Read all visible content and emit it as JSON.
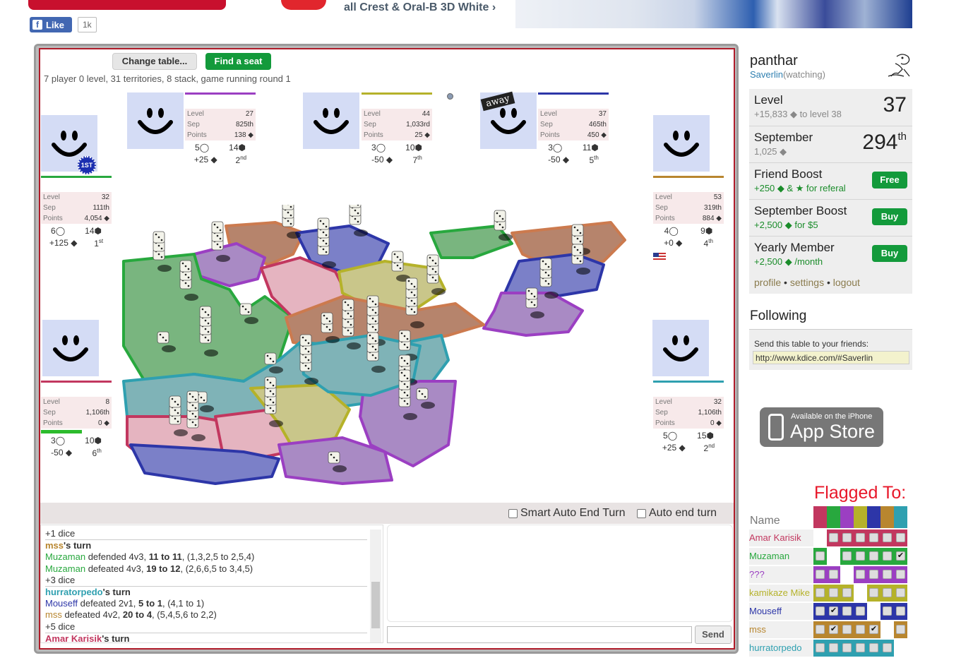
{
  "banner": {
    "ad_text": "all Crest & Oral-B 3D White ›",
    "fb_like": "Like",
    "fb_count": "1k"
  },
  "table": {
    "change_table": "Change table...",
    "find_seat": "Find a seat",
    "info": "7 player 0 level, 31 territories, 8 stack, game running round 1"
  },
  "players": [
    {
      "id": "top1",
      "level": "27",
      "sep": "825th",
      "points": "138 ◆",
      "dice": "5",
      "terr": "14",
      "delta": "+25 ◆",
      "place": "2",
      "place_sup": "nd",
      "color": "#9b3fc2"
    },
    {
      "id": "top2",
      "level": "44",
      "sep": "1,033rd",
      "points": "25 ◆",
      "dice": "3",
      "terr": "10",
      "delta": "-50 ◆",
      "place": "7",
      "place_sup": "th",
      "color": "#b5b22a"
    },
    {
      "id": "top3",
      "level": "37",
      "sep": "465th",
      "points": "450 ◆",
      "dice": "3",
      "terr": "11",
      "delta": "-50 ◆",
      "place": "5",
      "place_sup": "th",
      "color": "#2d36a8",
      "badge": "away"
    },
    {
      "id": "left1",
      "level": "32",
      "sep": "111th",
      "points": "4,054 ◆",
      "dice": "6",
      "terr": "14",
      "delta": "+125 ◆",
      "place": "1",
      "place_sup": "st",
      "color": "#28a83e",
      "badge": "1ST"
    },
    {
      "id": "right1",
      "level": "53",
      "sep": "319th",
      "points": "884 ◆",
      "dice": "4",
      "terr": "9",
      "delta": "+0 ◆",
      "place": "4",
      "place_sup": "th",
      "color": "#b8862f"
    },
    {
      "id": "left2",
      "level": "8",
      "sep": "1,106th",
      "points": "0 ◆",
      "dice": "3",
      "terr": "10",
      "delta": "-50 ◆",
      "place": "6",
      "place_sup": "th",
      "color": "#c2375f"
    },
    {
      "id": "right2",
      "level": "32",
      "sep": "1,106th",
      "points": "0 ◆",
      "dice": "5",
      "terr": "15",
      "delta": "+25 ◆",
      "place": "2",
      "place_sup": "nd",
      "color": "#2fa0b0"
    }
  ],
  "labels": {
    "level": "Level",
    "sep": "Sep",
    "points": "Points"
  },
  "options": {
    "smart_auto": "Smart Auto End Turn",
    "auto_end": "Auto end turn"
  },
  "log": [
    {
      "type": "plain",
      "parts": [
        {
          "t": "+1 dice"
        }
      ]
    },
    {
      "type": "turn",
      "parts": [
        {
          "t": "mss",
          "c": "#b8862f"
        },
        {
          "t": "'s turn"
        }
      ]
    },
    {
      "type": "plain",
      "parts": [
        {
          "t": "Muzaman",
          "c": "#28a83e"
        },
        {
          "t": " defended 4v3, "
        },
        {
          "t": "11 to 11",
          "b": true
        },
        {
          "t": ", (1,3,2,5 to 2,5,4)"
        }
      ]
    },
    {
      "type": "plain",
      "parts": [
        {
          "t": "Muzaman",
          "c": "#28a83e"
        },
        {
          "t": " defeated 4v3, "
        },
        {
          "t": "19 to 12",
          "b": true
        },
        {
          "t": ", (2,6,6,5 to 3,4,5)"
        }
      ]
    },
    {
      "type": "plain",
      "parts": [
        {
          "t": "+3 dice"
        }
      ]
    },
    {
      "type": "turn",
      "parts": [
        {
          "t": "hurratorpedo",
          "c": "#2fa0b0"
        },
        {
          "t": "'s turn"
        }
      ]
    },
    {
      "type": "plain",
      "parts": [
        {
          "t": "Mouseff",
          "c": "#2d36a8"
        },
        {
          "t": " defeated 2v1, "
        },
        {
          "t": "5 to 1",
          "b": true
        },
        {
          "t": ", (4,1 to 1)"
        }
      ]
    },
    {
      "type": "plain",
      "parts": [
        {
          "t": "mss",
          "c": "#b8862f"
        },
        {
          "t": " defeated 4v2, "
        },
        {
          "t": "20 to 4",
          "b": true
        },
        {
          "t": ", (5,4,5,6 to 2,2)"
        }
      ]
    },
    {
      "type": "plain",
      "parts": [
        {
          "t": "+5 dice"
        }
      ]
    },
    {
      "type": "turn",
      "parts": [
        {
          "t": "Amar Karisik",
          "c": "#c2375f"
        },
        {
          "t": "'s turn"
        }
      ]
    }
  ],
  "chat": {
    "send": "Send"
  },
  "sidebar": {
    "username": "panthar",
    "watching_name": "Saverlin",
    "watching_suffix": "(watching)",
    "level_label": "Level",
    "level_value": "37",
    "level_sub": "+15,833 ◆ to level 38",
    "month_label": "September",
    "month_value": "294",
    "month_sup": "th",
    "month_sub": "1,025 ◆",
    "friend_label": "Friend Boost",
    "friend_sub": "+250 ◆ & ★ for referal",
    "friend_btn": "Free",
    "sept_label": "September Boost",
    "sept_sub": "+2,500 ◆ for $5",
    "sept_btn": "Buy",
    "yearly_label": "Yearly Member",
    "yearly_sub": "+2,500 ◆ /month",
    "yearly_btn": "Buy",
    "link_profile": "profile",
    "link_settings": "settings",
    "link_logout": "logout",
    "following": "Following",
    "share_label": "Send this table to your friends:",
    "share_url": "http://www.kdice.com/#Saverlin",
    "appstore_small": "Available on the iPhone",
    "appstore_large": "App Store"
  },
  "flagged": {
    "title": "Flagged To:",
    "name_header": "Name",
    "colors": [
      "#c2375f",
      "#28a83e",
      "#9b3fc2",
      "#b5b22a",
      "#2d36a8",
      "#b8862f",
      "#2fa0b0"
    ],
    "rows": [
      {
        "name": "Amar Karisik",
        "color": "#c2375f",
        "checks": [
          "self",
          "",
          "",
          "",
          "",
          "",
          ""
        ]
      },
      {
        "name": "Muzaman",
        "color": "#28a83e",
        "checks": [
          "",
          "self",
          "",
          "",
          "",
          "",
          "x"
        ]
      },
      {
        "name": "???",
        "color": "#9b3fc2",
        "checks": [
          "",
          "",
          "self",
          "",
          "",
          "",
          ""
        ]
      },
      {
        "name": "kamikaze Mike",
        "color": "#b5b22a",
        "checks": [
          "",
          "",
          "",
          "self",
          "",
          "",
          ""
        ]
      },
      {
        "name": "Mouseff",
        "color": "#2d36a8",
        "checks": [
          "",
          "x",
          "",
          "",
          "self",
          "",
          ""
        ]
      },
      {
        "name": "mss",
        "color": "#b8862f",
        "checks": [
          "",
          "x",
          "",
          "",
          "x",
          "self",
          ""
        ]
      },
      {
        "name": "hurratorpedo",
        "color": "#2fa0b0",
        "checks": [
          "",
          "",
          "",
          "",
          "",
          "",
          "self"
        ]
      }
    ]
  }
}
